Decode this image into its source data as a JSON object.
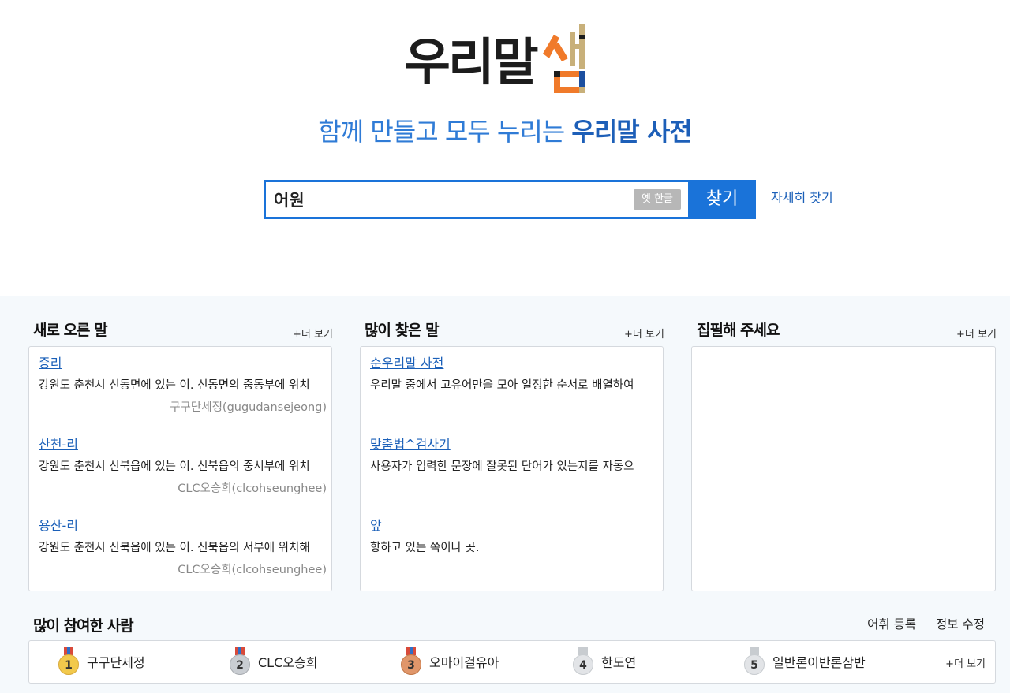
{
  "logo": {
    "text": "우리말샘"
  },
  "tagline": {
    "normal": "함께 만들고 모두 누리는 ",
    "bold": "우리말 사전"
  },
  "search": {
    "value": "어원",
    "old_hangul_label": "옛 한글",
    "submit_label": "찾기",
    "advanced_label": "자세히 찾기"
  },
  "new_words": {
    "title": "새로 오른 말",
    "more_label": "+더 보기",
    "items": [
      {
        "word": "증리",
        "definition": "강원도 춘천시 신동면에 있는 이. 신동면의 중동부에 위치",
        "author": "구구단세정(gugudansejeong)"
      },
      {
        "word": "산천-리",
        "definition": "강원도 춘천시 신북읍에 있는 이. 신북읍의 중서부에 위치",
        "author": "CLC오승희(clcohseunghee)"
      },
      {
        "word": "용산-리",
        "definition": "강원도 춘천시 신북읍에 있는 이. 신북읍의 서부에 위치해",
        "author": "CLC오승희(clcohseunghee)"
      }
    ]
  },
  "popular_words": {
    "title": "많이 찾은 말",
    "more_label": "+더 보기",
    "items": [
      {
        "word": "순우리말 사전",
        "definition": "우리말 중에서 고유어만을 모아 일정한 순서로 배열하여"
      },
      {
        "word": "맞춤법^검사기",
        "definition": "사용자가 입력한 문장에 잘못된 단어가 있는지를 자동으"
      },
      {
        "word": "앞",
        "definition": "향하고 있는 쪽이나 곳."
      }
    ]
  },
  "please_write": {
    "title": "집필해 주세요",
    "more_label": "+더 보기"
  },
  "top_contributors": {
    "title": "많이 참여한 사람",
    "register_label": "어휘 등록",
    "edit_label": "정보 수정",
    "more_label": "+더 보기",
    "people": [
      {
        "rank": "1",
        "name": "구구단세정",
        "medal_color": "#f2c94c",
        "ribbon_color": "#d84a3a"
      },
      {
        "rank": "2",
        "name": "CLC오승희",
        "medal_color": "#c9cdd2",
        "ribbon_color": "#d84a3a"
      },
      {
        "rank": "3",
        "name": "오마이걸유아",
        "medal_color": "#e0966a",
        "ribbon_color": "#d84a3a"
      },
      {
        "rank": "4",
        "name": "한도연",
        "medal_color": "#e2e4e7",
        "ribbon_color": "#c8ccd0"
      },
      {
        "rank": "5",
        "name": "일반론이반론삼반",
        "medal_color": "#e2e4e7",
        "ribbon_color": "#c8ccd0"
      }
    ]
  },
  "colors": {
    "accent": "#1a73d9",
    "link": "#1a5fb8",
    "logo_orange": "#f07a2a",
    "logo_tan": "#c8b07a"
  }
}
